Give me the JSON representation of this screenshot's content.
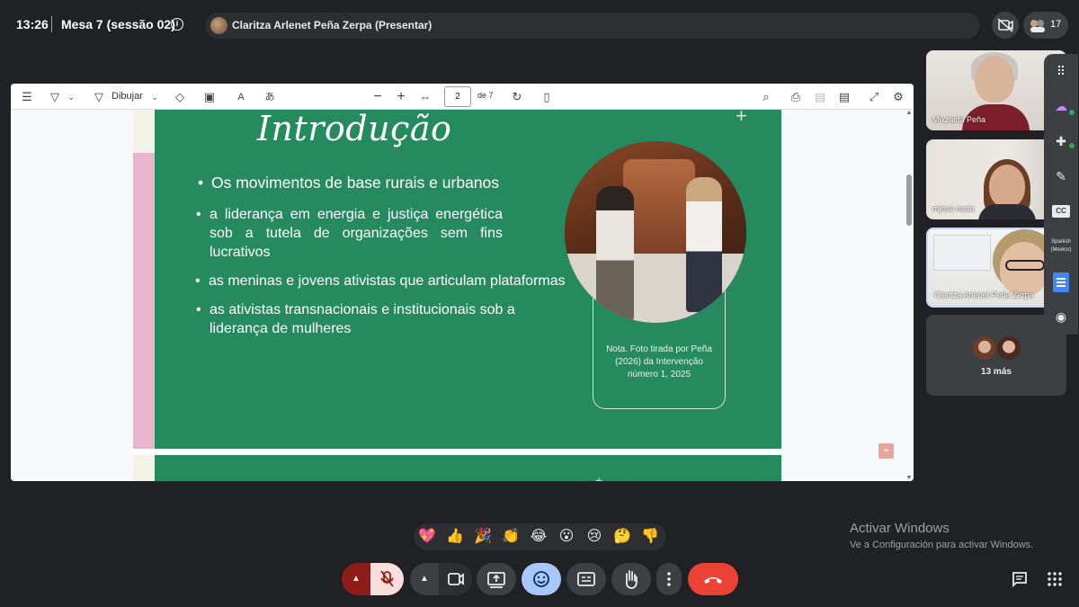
{
  "meeting": {
    "clock": "13:26",
    "title": "Mesa 7 (sessão 02)",
    "presenter_label": "Claritza Arlenet Peña Zerpa (Presentar)",
    "participant_count": "17"
  },
  "pdf_toolbar": {
    "draw_label": "Dibujar",
    "page_current": "2",
    "page_total": "de 7",
    "icons": [
      "outline-icon",
      "highlighter-icon",
      "draw-icon",
      "eraser-icon",
      "text-box-icon",
      "read-aloud-icon",
      "translate-icon",
      "zoom-out-icon",
      "zoom-in-icon",
      "fit-page-icon",
      "rotate-icon",
      "two-page-icon",
      "search-icon",
      "print-icon",
      "save-icon",
      "save-as-icon",
      "fullscreen-icon",
      "settings-icon"
    ]
  },
  "slide": {
    "title": "Introdução",
    "bullets": [
      "Os movimentos de base rurais e urbanos",
      "a liderança em energia e justiça energética sob a tutela de organizações sem fins lucrativos",
      "as meninas e jovens ativistas que articulam plataformas",
      "as ativistas transnacionais e institucionais sob a liderança de mulheres"
    ],
    "photo_caption": "Nota. Foto tirada por Peña (2026) da Intervenção número 1, 2025",
    "accent_green": "#268a5f",
    "accent_pink": "#e7b6cc"
  },
  "participants": [
    {
      "name": "Mixzaida Peña"
    },
    {
      "name": "mjose mata"
    },
    {
      "name": "Claritza Arlenet Peña Zerpa"
    }
  ],
  "more_participants": "13 más",
  "side_panel": {
    "caption_label": "CC",
    "language": "Spanish (Mexico)"
  },
  "reactions": [
    "💖",
    "👍",
    "🎉",
    "👏",
    "😂",
    "😮",
    "😢",
    "🤔",
    "👎"
  ],
  "activate_windows": {
    "title": "Activar Windows",
    "subtitle": "Ve a Configuración para activar Windows."
  },
  "colors": {
    "background": "#202124",
    "hangup": "#ea4335",
    "mic_off": "#8c1d18",
    "emoji_active": "#a8c7fa"
  }
}
